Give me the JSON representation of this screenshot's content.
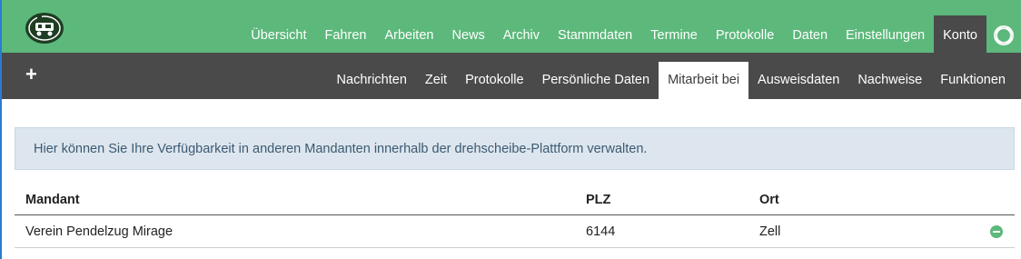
{
  "colors": {
    "brand_green": "#5cb87b",
    "dark_bar": "#4a4a4a",
    "info_bg": "#dde6ee",
    "info_text": "#3c5a73"
  },
  "top_nav": {
    "items": [
      "Übersicht",
      "Fahren",
      "Arbeiten",
      "News",
      "Archiv",
      "Stammdaten",
      "Termine",
      "Protokolle",
      "Daten",
      "Einstellungen",
      "Konto"
    ],
    "active": "Konto",
    "help_icon": "lifebuoy-icon"
  },
  "sub_nav": {
    "add_icon": "plus-icon",
    "add_label": "+",
    "items": [
      "Nachrichten",
      "Zeit",
      "Protokolle",
      "Persönliche Daten",
      "Mitarbeit bei",
      "Ausweisdaten",
      "Nachweise",
      "Funktionen"
    ],
    "active": "Mitarbeit bei"
  },
  "info_text": "Hier können Sie Ihre Verfügbarkeit in anderen Mandanten innerhalb der drehscheibe-Plattform verwalten.",
  "table": {
    "headers": {
      "mandant": "Mandant",
      "plz": "PLZ",
      "ort": "Ort"
    },
    "rows": [
      {
        "mandant": "Verein Pendelzug Mirage",
        "plz": "6144",
        "ort": "Zell",
        "action_icon": "minus-circle-icon"
      }
    ]
  }
}
